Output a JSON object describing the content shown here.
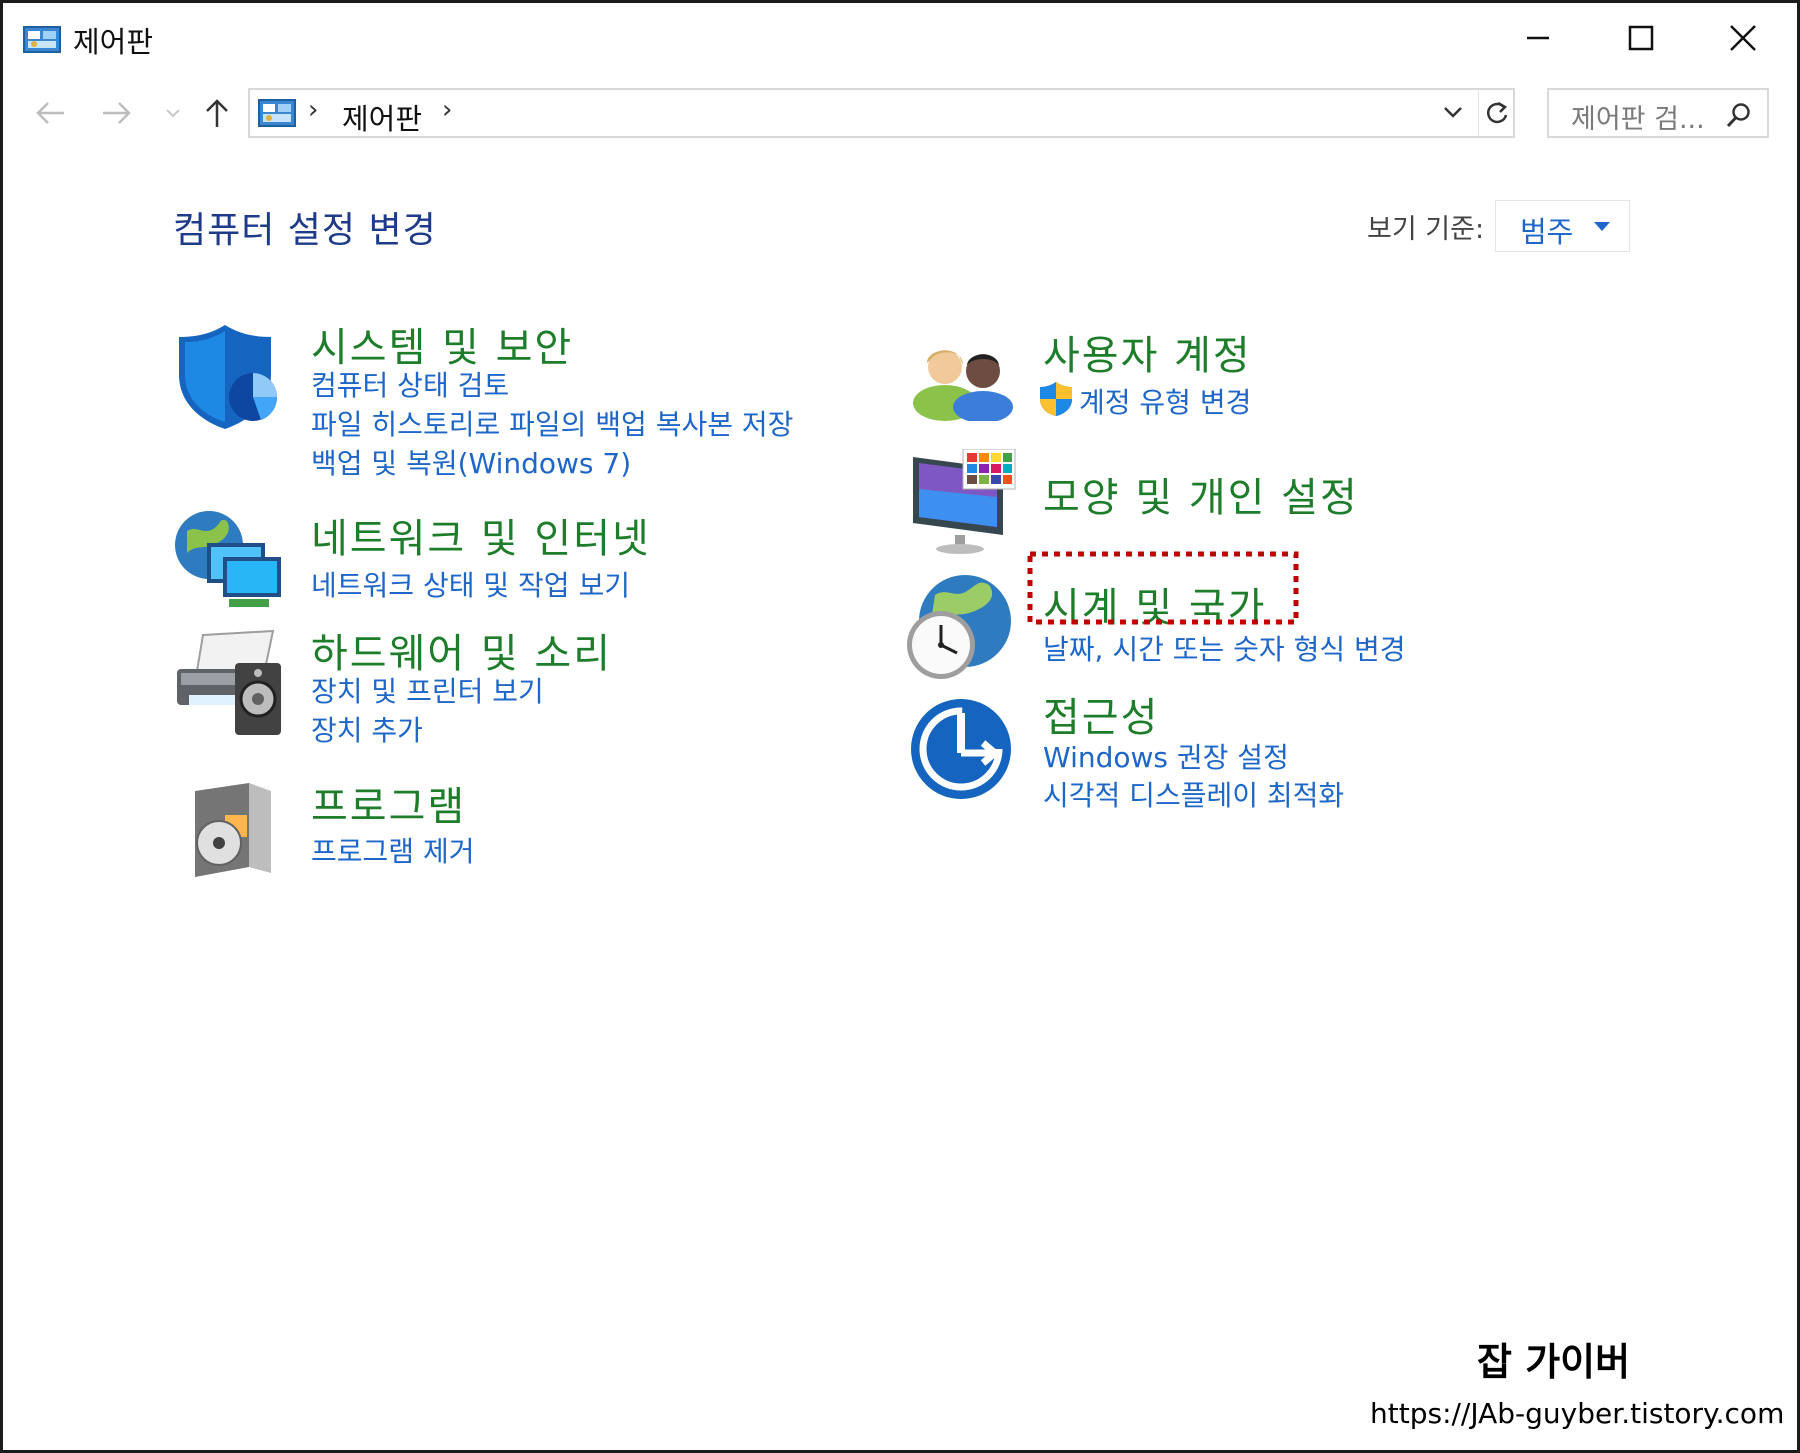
{
  "window": {
    "title": "제어판"
  },
  "nav": {
    "breadcrumb": "제어판",
    "breadcrumb_separator": "›",
    "search_placeholder": "제어판 검..."
  },
  "header": {
    "title": "컴퓨터 설정 변경",
    "view_by_label": "보기 기준:",
    "view_by_value": "범주"
  },
  "categories_left": [
    {
      "title": "시스템 및 보안",
      "icon": "shield-icon",
      "links": [
        "컴퓨터 상태 검토",
        "파일 히스토리로 파일의 백업 복사본 저장",
        "백업 및 복원(Windows 7)"
      ]
    },
    {
      "title": "네트워크 및 인터넷",
      "icon": "network-icon",
      "links": [
        "네트워크 상태 및 작업 보기"
      ]
    },
    {
      "title": "하드웨어 및 소리",
      "icon": "printer-icon",
      "links": [
        "장치 및 프린터 보기",
        "장치 추가"
      ]
    },
    {
      "title": "프로그램",
      "icon": "programs-icon",
      "links": [
        "프로그램 제거"
      ]
    }
  ],
  "categories_right": [
    {
      "title": "사용자 계정",
      "icon": "users-icon",
      "links": [
        "계정 유형 변경"
      ]
    },
    {
      "title": "모양 및 개인 설정",
      "icon": "monitor-icon",
      "links": []
    },
    {
      "title": "시계 및 국가",
      "icon": "clock-globe-icon",
      "links": [
        "날짜, 시간 또는 숫자 형식 변경"
      ]
    },
    {
      "title": "접근성",
      "icon": "accessibility-icon",
      "links": [
        "Windows 권장 설정",
        "시각적 디스플레이 최적화"
      ]
    }
  ],
  "watermark": {
    "name": "잡 가이버",
    "url": "https://JAb-guyber.tistory.com"
  },
  "colors": {
    "category_title": "#1e7d2a",
    "link": "#1e66c8",
    "page_title": "#1e3a8a",
    "highlight_box": "#c00000"
  }
}
